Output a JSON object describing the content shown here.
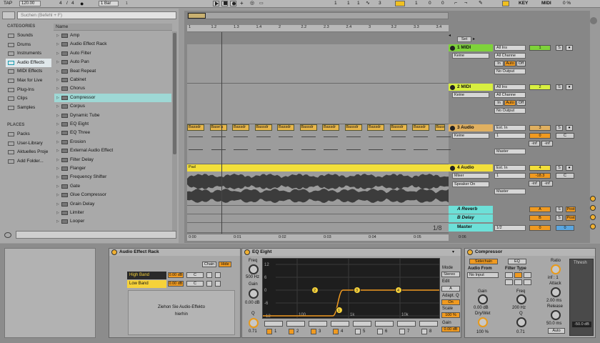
{
  "topbar": {
    "tap": "TAP",
    "bpm": "120.00",
    "meter_num": "4",
    "meter_den": "4",
    "quantize": "1 Bar",
    "pos1": "1",
    "pos2": "1",
    "pos3": "1",
    "loop1": "3",
    "loop2": "1",
    "loop3": "1",
    "loopend1": "1",
    "loopend2": "0",
    "loopend3": "0",
    "key": "KEY",
    "midi": "MIDI",
    "cpu": "0 %"
  },
  "browser": {
    "search_placeholder": "Suchen (Befehl + F)",
    "categories_title": "CATEGORIES",
    "categories": [
      "Sounds",
      "Drums",
      "Instruments",
      "Audio Effects",
      "MIDI Effects",
      "Max for Live",
      "Plug-Ins",
      "Clips",
      "Samples"
    ],
    "places_title": "PLACES",
    "places": [
      "Packs",
      "User-Library",
      "Aktuelles Proje",
      "Add Folder..."
    ],
    "name_header": "Name",
    "items": [
      "Amp",
      "Audio Effect Rack",
      "Auto Filter",
      "Auto Pan",
      "Beat Repeat",
      "Cabinet",
      "Chorus",
      "Compressor",
      "Corpus",
      "Dynamic Tube",
      "EQ Eight",
      "EQ Three",
      "Erosion",
      "External Audio Effect",
      "Filter Delay",
      "Flanger",
      "Frequency Shifter",
      "Gate",
      "Glue Compressor",
      "Grain Delay",
      "Limiter",
      "Looper"
    ]
  },
  "arrangement": {
    "ruler": [
      "1",
      "1.2",
      "1.3",
      "1.4",
      "2",
      "2.2",
      "2.3",
      "2.4",
      "3",
      "3.2",
      "3.3",
      "3.4"
    ],
    "timeline": [
      "0:00",
      "0:01",
      "0:02",
      "0:03",
      "0:04",
      "0:05",
      "0:06"
    ],
    "set_label": "Set",
    "clip_label": "Bassdr",
    "clip_alt": "Base'a",
    "pad_clip": "Pad",
    "page": "1/8",
    "tracks": [
      {
        "name": "1 MIDI",
        "color": "#7ed23a",
        "num": "1",
        "device": "Keine",
        "input": "All Ins",
        "channel": "All Channe",
        "monitor_in": "In",
        "monitor_auto": "Auto",
        "monitor_off": "Off",
        "output": "No Output"
      },
      {
        "name": "2 MIDI",
        "color": "#d8ef40",
        "num": "2",
        "device": "Keine",
        "input": "All Ins",
        "channel": "All Channe",
        "monitor_in": "In",
        "monitor_auto": "Auto",
        "monitor_off": "Off",
        "output": "No Output"
      },
      {
        "name": "3 Audio",
        "color": "#e0b060",
        "num": "3",
        "device": "Keine",
        "input": "Ext. In",
        "channel": "1",
        "vol": "0",
        "pan": "C",
        "out": "Master",
        "inf1": "-inf",
        "inf2": "-inf"
      },
      {
        "name": "4 Audio",
        "color": "#f2df3a",
        "num": "4",
        "device": "Mixer",
        "device2": "Speaker On",
        "input": "Ext. In",
        "channel": "1",
        "vol": "-18.3",
        "pan": "C",
        "out": "Master",
        "inf1": "-inf",
        "inf2": "-inf"
      }
    ],
    "returns": [
      {
        "name": "A Reverb",
        "letter": "A",
        "post": "Post"
      },
      {
        "name": "B Delay",
        "letter": "B",
        "post": "Post"
      }
    ],
    "master": {
      "name": "Master",
      "sel": "1/2",
      "vol": "0",
      "pan": "0"
    },
    "solo": "S",
    "rec": "●"
  },
  "rack": {
    "title": "Audio Effect Rack",
    "chain": "Chain",
    "hide": "Hide",
    "chains": [
      {
        "name": "High Band",
        "vol": "0.00 dB",
        "pan": "C"
      },
      {
        "name": "Low Band",
        "vol": "0.00 dB",
        "pan": "C"
      }
    ],
    "drop_hint_1": "Ziehon Sie Audio-Effekto",
    "drop_hint_2": "hierhin"
  },
  "eq": {
    "title": "EQ Eight",
    "freq_label": "Freq",
    "freq": "500 Hz",
    "gain_label": "Gain",
    "gain": "0.00 dB",
    "q": "0.71",
    "q_label": "Q",
    "y_ticks": [
      "12",
      "6",
      "0",
      "-6",
      "-12"
    ],
    "x_ticks": [
      "100",
      "1k",
      "10k"
    ],
    "mode_label": "Mode",
    "mode": "Stereo",
    "edit_label": "Edit",
    "edit": "A",
    "adapt_label": "Adapt. Q",
    "adapt": "On",
    "scale_label": "Scale",
    "scale": "100 %",
    "out_gain_label": "Gain",
    "out_gain": "0.00 dB",
    "bands": [
      "1",
      "2",
      "3",
      "4",
      "5",
      "6",
      "7",
      "8"
    ]
  },
  "comp": {
    "title": "Compressor",
    "sidechain": "Sidechain",
    "eq": "EQ",
    "audio_from": "Audio From",
    "no_input": "No Input",
    "filter_type": "Filter Type",
    "gain_label": "Gain",
    "gain": "0.00 dB",
    "drywet_label": "Dry/Wet",
    "drywet": "100 %",
    "freq_label": "Freq",
    "freq": "200 Hz",
    "q_label": "Q",
    "q": "0.71",
    "ratio_label": "Ratio",
    "ratio": "inf : 1",
    "attack_label": "Attack",
    "attack": "2.00 ms",
    "release_label": "Release",
    "release": "50.0 ms",
    "auto": "Auto",
    "thresh_label": "Thresh",
    "thresh": "-50.0 dB"
  }
}
